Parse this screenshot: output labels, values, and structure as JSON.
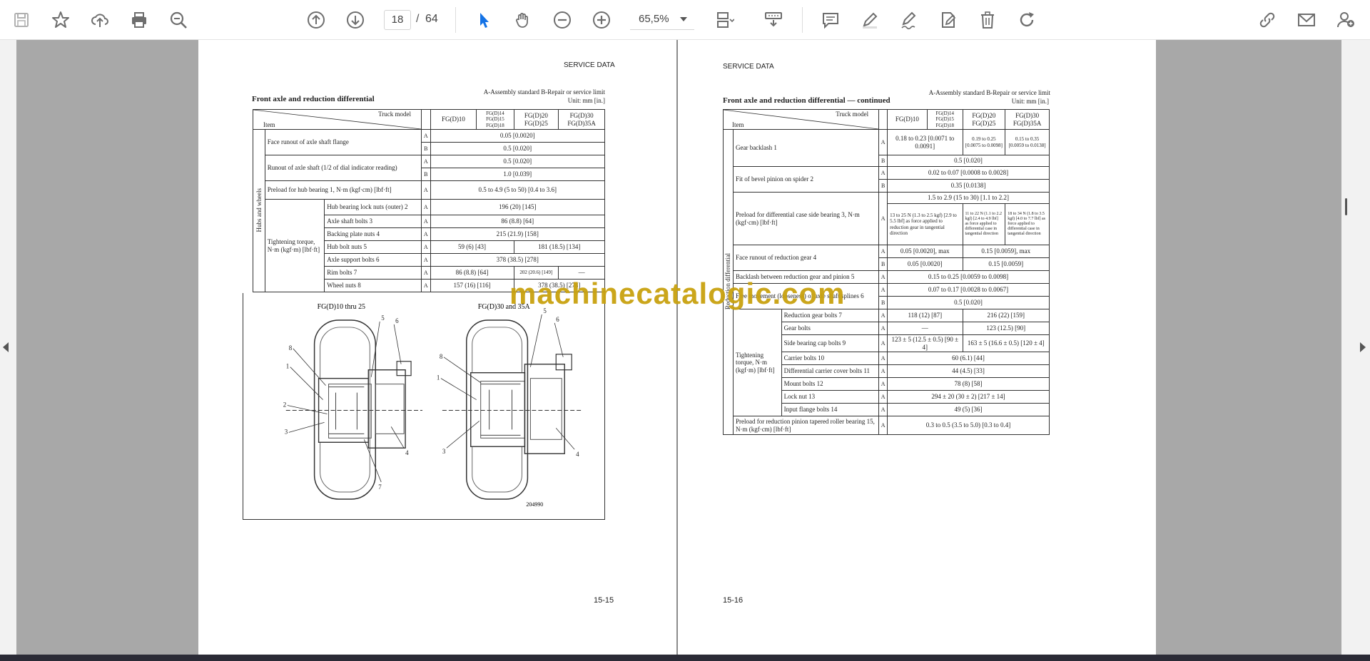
{
  "toolbar": {
    "current_page": "18",
    "page_separator": "/",
    "total_pages": "64",
    "zoom": "65,5%"
  },
  "left_page": {
    "header": "SERVICE DATA",
    "title": "Front axle and reduction differential",
    "standard_note": "A-Assembly standard   B-Repair or service limit",
    "unit": "Unit: mm [in.]",
    "col_truck_model": "Truck model",
    "col_item": "Item",
    "models": [
      "FG(D)10",
      "FG(D)14 FG(D)15 FG(D)18",
      "FG(D)20 FG(D)25",
      "FG(D)30 FG(D)35A"
    ],
    "group_label": "Hubs and wheels",
    "tighten_label": "Tightening torque, N·m (kgf·m) [lbf·ft]",
    "rows": [
      {
        "item": "Face runout of axle shaft flange",
        "a": "0.05 [0.0020]",
        "b": "0.5 [0.020]"
      },
      {
        "item": "Runout of axle shaft (1/2 of dial indicator reading)",
        "a": "0.5 [0.020]",
        "b": "1.0 [0.039]"
      },
      {
        "item": "Preload for hub bearing 1, N·m (kgf·cm) [lbf·ft]",
        "a": "0.5 to 4.9 (5 to 50) [0.4 to 3.6]"
      }
    ],
    "torque_rows": [
      {
        "item": "Hub bearing lock nuts (outer) 2",
        "v": "196 (20) [145]"
      },
      {
        "item": "Axle shaft bolts 3",
        "v": "86 (8.8) [64]"
      },
      {
        "item": "Backing plate nuts 4",
        "v": "215 (21.9) [158]"
      },
      {
        "item": "Hub bolt nuts 5",
        "v1": "59 (6) [43]",
        "v2": "181 (18.5) [134]"
      },
      {
        "item": "Axle support bolts 6",
        "v": "378 (38.5) [278]"
      },
      {
        "item": "Rim bolts 7",
        "v1": "86 (8.8) [64]",
        "v2": "202 (20.6) [149]",
        "v3": "—"
      },
      {
        "item": "Wheel nuts 8",
        "v1": "157 (16) [116]",
        "v2": "378 (38.5) [278]"
      }
    ],
    "fig_left_caption": "FG(D)10 thru 25",
    "fig_right_caption": "FG(D)30 and 35A",
    "fig_code": "204990",
    "page_number": "15-15"
  },
  "right_page": {
    "header": "SERVICE DATA",
    "title": "Front axle and reduction differential — continued",
    "standard_note": "A-Assembly standard   B-Repair or service limit",
    "unit": "Unit: mm [in.]",
    "col_truck_model": "Truck model",
    "col_item": "Item",
    "models": [
      "FG(D)10",
      "FG(D)14 FG(D)15 FG(D)18",
      "FG(D)20 FG(D)25",
      "FG(D)30 FG(D)35A"
    ],
    "group_label": "Reduction differential",
    "tighten_label": "Tightening torque, N·m (kgf·m) [lbf·ft]",
    "gear_backlash": {
      "item": "Gear backlash 1",
      "a1": "0.18 to 0.23 [0.0071 to 0.0091]",
      "a2": "0.19 to 0.25 [0.0075 to 0.0098]",
      "a3": "0.15 to 0.35 [0.0059 to 0.0138]",
      "b": "0.5 [0.020]"
    },
    "bevel_fit": {
      "item": "Fit of bevel pinion on spider 2",
      "a": "0.02 to 0.07 [0.0008 to 0.0028]",
      "b": "0.35 [0.0138]"
    },
    "preload_case": {
      "item": "Preload for differential case side bearing 3, N·m (kgf·cm) [lbf·ft]",
      "top": "1.5 to 2.9 (15 to 30) [1.1 to 2.2]",
      "c1": "13 to 25 N (1.3 to 2.5 kgf) [2.9 to 5.5 lbf] as force applied to reduction gear in tangential direction",
      "c2": "11 to 22 N (1.1 to 2.2 kgf) [2.4 to 4.9 lbf] as force applied to differential case in tangential direction",
      "c3": "18 to 34 N (1.8 to 3.5 kgf) [4.0 to 7.7 lbf] as force applied to differential case in tangential direction"
    },
    "face_runout": {
      "item": "Face runout of reduction gear 4",
      "a1": "0.05 [0.0020], max",
      "a2": "0.15 [0.0059], max",
      "b1": "0.05 [0.0020]",
      "b2": "0.15 [0.0059]"
    },
    "backlash_5": {
      "item": "Backlash between reduction gear and pinion 5",
      "a": "0.15 to 0.25 [0.0059 to 0.0098]"
    },
    "free_move": {
      "item": "Free movement (looseness) of axle shaft splines 6",
      "a": "0.07 to 0.17 [0.0028 to 0.0067]",
      "b": "0.5 [0.020]"
    },
    "torque_rows": [
      {
        "item": "Reduction gear bolts 7",
        "v1": "118 (12) [87]",
        "v2": "216 (22) [159]"
      },
      {
        "item": "Gear bolts",
        "v1": "—",
        "v2": "123 (12.5) [90]"
      },
      {
        "item": "Side bearing cap bolts 9",
        "v1": "123 ± 5 (12.5 ± 0.5) [90 ± 4]",
        "v2": "163 ± 5 (16.6 ± 0.5) [120 ± 4]"
      },
      {
        "item": "Carrier bolts 10",
        "v": "60 (6.1) [44]"
      },
      {
        "item": "Differential carrier cover bolts 11",
        "v": "44 (4.5) [33]"
      },
      {
        "item": "Mount bolts 12",
        "v": "78 (8) [58]"
      },
      {
        "item": "Lock nut 13",
        "v": "294 ± 20 (30 ± 2) [217 ± 14]"
      },
      {
        "item": "Input flange bolts 14",
        "v": "49 (5) [36]"
      }
    ],
    "preload_pinion": {
      "item": "Preload for reduction pinion tapered roller bearing 15, N·m (kgf·cm) [lbf·ft]",
      "a": "0.3 to 0.5 (3.5 to 5.0) [0.3 to 0.4]"
    },
    "page_number": "15-16"
  },
  "watermark": "machinecatalogic.com",
  "labels": {
    "A": "A",
    "B": "B"
  },
  "icons": [
    "save-icon",
    "bookmark-star-icon",
    "upload-cloud-icon",
    "print-icon",
    "zoom-search-icon",
    "previous-page-icon",
    "next-page-icon",
    "select-arrow-icon",
    "hand-tool-icon",
    "zoom-out-icon",
    "zoom-in-icon",
    "page-layout-icon",
    "stamp-icon",
    "comment-icon",
    "highlight-pen-icon",
    "sign-icon",
    "edit-document-icon",
    "delete-icon",
    "redo-icon",
    "share-link-icon",
    "mail-icon",
    "add-user-icon"
  ],
  "colors": {
    "accent": "#1473e6",
    "watermark": "#c9a20f",
    "icon": "#6e6e6e",
    "viewer_bg": "#a8a8a8"
  }
}
